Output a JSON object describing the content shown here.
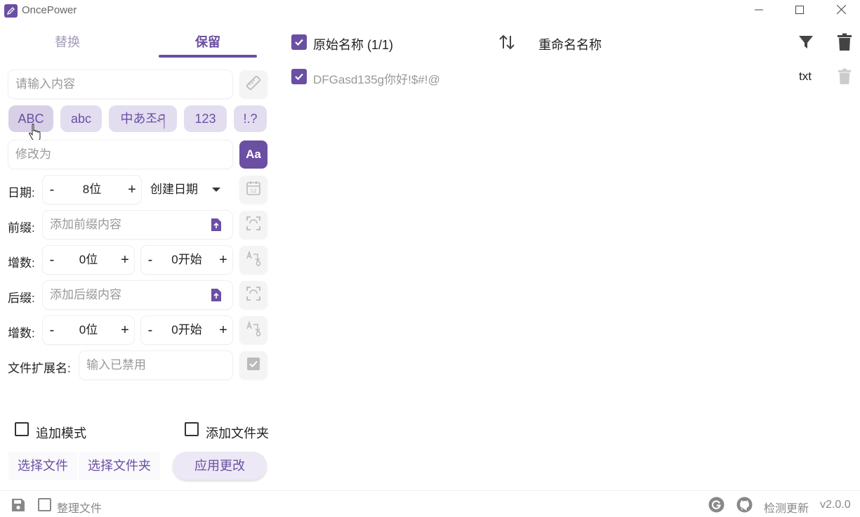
{
  "app": {
    "title": "OncePower"
  },
  "tabs": [
    {
      "label": "替换",
      "active": false
    },
    {
      "label": "保留",
      "active": true
    }
  ],
  "inputs": {
    "content_placeholder": "请输入内容",
    "modify_placeholder": "修改为",
    "prefix_placeholder": "添加前缀内容",
    "suffix_placeholder": "添加后缀内容",
    "ext_placeholder": "输入已禁用"
  },
  "chips": [
    {
      "label": "ABC",
      "selected": true
    },
    {
      "label": "abc",
      "selected": false
    },
    {
      "label": "中あ조ཤ",
      "selected": false
    },
    {
      "label": "123",
      "selected": false
    },
    {
      "label": "!.?",
      "selected": false
    }
  ],
  "case_button_label": "Aa",
  "date": {
    "label": "日期:",
    "minus": "-",
    "value": "8位",
    "plus": "+",
    "dropdown_value": "创建日期"
  },
  "prefix": {
    "label": "前缀:"
  },
  "prefix_increment": {
    "label": "增数:",
    "digits": "0位",
    "start": "0开始"
  },
  "suffix": {
    "label": "后缀:"
  },
  "suffix_increment": {
    "label": "增数:",
    "digits": "0位",
    "start": "0开始"
  },
  "extension": {
    "label": "文件扩展名:"
  },
  "stepper_symbols": {
    "minus": "-",
    "plus": "+"
  },
  "options": {
    "append_mode": "追加模式",
    "add_folder": "添加文件夹"
  },
  "actions": {
    "select_files": "选择文件",
    "select_folder": "选择文件夹",
    "apply": "应用更改"
  },
  "table": {
    "original_header": "原始名称 (1/1)",
    "renamed_header": "重命名名称",
    "rows": [
      {
        "name": "DFGasd135g你好!$#!@",
        "ext": "txt",
        "checked": true
      }
    ]
  },
  "status": {
    "organize_files": "整理文件",
    "check_update": "检测更新",
    "version": "v2.0.0"
  },
  "colors": {
    "accent": "#6a4fa3",
    "chip_bg": "#e3ddf0",
    "muted_text": "#999999"
  },
  "icons": [
    "pen-icon",
    "minimize-icon",
    "maximize-icon",
    "close-icon",
    "ruler-icon",
    "calendar-icon",
    "file-upload-icon",
    "refresh-icon",
    "text-counter-icon",
    "checkbox-icon",
    "sort-icon",
    "filter-icon",
    "trash-icon",
    "save-icon",
    "google-icon",
    "github-icon",
    "cursor-icon"
  ]
}
